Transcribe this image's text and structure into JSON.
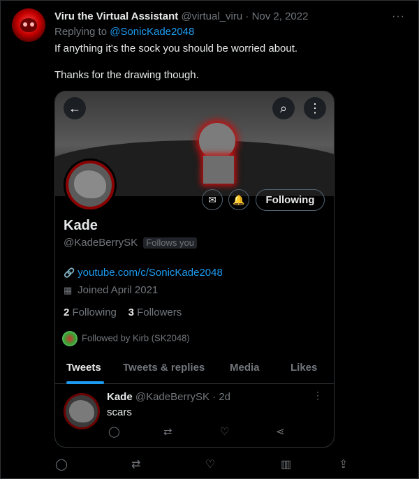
{
  "tweet": {
    "author_name": "Viru the Virtual Assistant",
    "author_handle": "@virtual_viru",
    "separator": "·",
    "date": "Nov 2, 2022",
    "replying_prefix": "Replying to",
    "replying_to": "@SonicKade2048",
    "text_line1": "If anything it's the sock you should be worried about.",
    "text_line2": "Thanks for the drawing though.",
    "more_glyph": "···"
  },
  "profile_card": {
    "back_glyph": "←",
    "search_glyph": "⌕",
    "menu_glyph": "⋮",
    "message_glyph": "✉",
    "notify_glyph": "🔔",
    "follow_label": "Following",
    "name": "Kade",
    "handle": "@KadeBerrySK",
    "follows_you": "Follows you",
    "link_glyph": "🔗",
    "website": "youtube.com/c/SonicKade2048",
    "calendar_glyph": "▦",
    "joined": "Joined April 2021",
    "following_count": "2",
    "following_label": "Following",
    "followers_count": "3",
    "followers_label": "Followers",
    "followed_by": "Followed by Kirb (SK2048)",
    "tabs": [
      "Tweets",
      "Tweets & replies",
      "Media",
      "Likes"
    ],
    "inner_tweet": {
      "name": "Kade",
      "handle": "@KadeBerrySK",
      "separator": "·",
      "time": "2d",
      "text": "scars",
      "more_glyph": "⋮",
      "reply_glyph": "◯",
      "retweet_glyph": "⇄",
      "like_glyph": "♡",
      "share_glyph": "⋖"
    }
  },
  "actions": {
    "reply_glyph": "◯",
    "retweet_glyph": "⇄",
    "like_glyph": "♡",
    "views_glyph": "▥",
    "share_glyph": "⇪"
  },
  "colors": {
    "background": "#000000",
    "accent": "#1d9bf0",
    "muted": "#71767b",
    "text": "#e7e9ea"
  }
}
